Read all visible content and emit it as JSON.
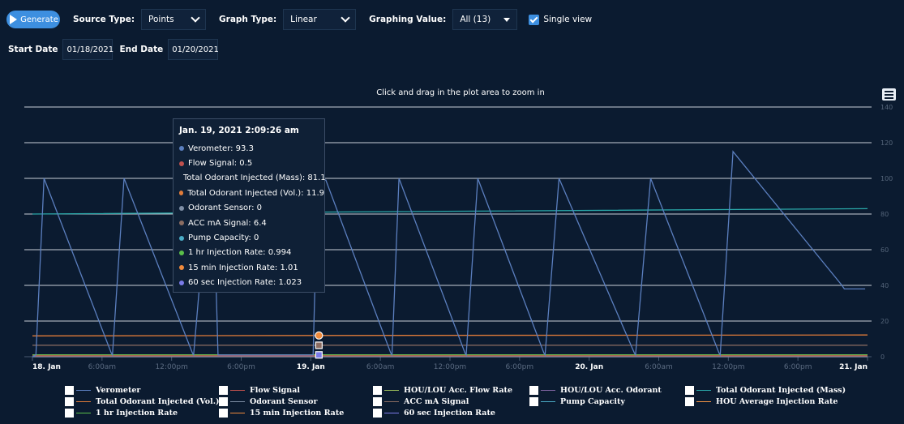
{
  "toolbar": {
    "generate_label": "Generate",
    "source_type_label": "Source Type:",
    "source_type_value": "Points",
    "graph_type_label": "Graph Type:",
    "graph_type_value": "Linear",
    "graphing_value_label": "Graphing Value:",
    "graphing_value_value": "All (13)",
    "single_view_label": "Single view",
    "single_view_checked": true
  },
  "dates": {
    "start_label": "Start Date",
    "start_value": "01/18/2021",
    "end_label": "End Date",
    "end_value": "01/20/2021"
  },
  "chart_data": {
    "type": "line",
    "subtitle": "Click and drag in the plot area to zoom in",
    "x_ticks": [
      "18. Jan",
      "6:00am",
      "12:00pm",
      "6:00pm",
      "19. Jan",
      "6:00am",
      "12:00pm",
      "6:00pm",
      "20. Jan",
      "6:00am",
      "12:00pm",
      "6:00pm",
      "21. Jan"
    ],
    "x_major_ticks": [
      "18. Jan",
      "19. Jan",
      "20. Jan",
      "21. Jan"
    ],
    "y_ticks": [
      0,
      20,
      40,
      60,
      80,
      100,
      120,
      140
    ],
    "ylim": [
      0,
      140
    ],
    "xlim_hours": [
      0,
      72
    ],
    "grid": true,
    "series": [
      {
        "name": "Verometer",
        "color": "#5b7fbf",
        "x": [
          0,
          0.3,
          1.0,
          6.8,
          6.9,
          7.9,
          13.8,
          13.9,
          15.2,
          15.6,
          16.0,
          24.2,
          24.6,
          25.3,
          30.9,
          31.0,
          31.6,
          37.3,
          37.4,
          38.4,
          44.1,
          44.2,
          45.4,
          51.9,
          52.0,
          53.3,
          59.2,
          59.3,
          60.4,
          69.8,
          70.0,
          71.8
        ],
        "values": [
          0,
          1,
          100,
          2,
          1,
          100,
          2,
          1,
          100,
          95,
          1,
          1,
          100,
          99,
          2,
          1,
          100,
          2,
          1,
          100,
          2,
          1,
          100,
          2,
          1,
          100,
          2,
          1,
          115,
          40,
          38,
          38
        ]
      },
      {
        "name": "Flow Signal",
        "color": "#c0504d",
        "x": [
          0,
          72
        ],
        "values": [
          0.5,
          0.5
        ]
      },
      {
        "name": "Total Odorant Injected (Mass)",
        "color": "#2aa7a8",
        "x": [
          0,
          24.7,
          72
        ],
        "values": [
          80,
          81.1,
          83
        ]
      },
      {
        "name": "Total Odorant Injected (Vol.)",
        "color": "#e07b39",
        "x": [
          0,
          24.7,
          72
        ],
        "values": [
          11.7,
          11.9,
          12.2
        ]
      },
      {
        "name": "Odorant Sensor",
        "color": "#7f8fa6",
        "x": [
          0,
          72
        ],
        "values": [
          0,
          0
        ]
      },
      {
        "name": "ACC mA Signal",
        "color": "#8c6d62",
        "x": [
          0,
          72
        ],
        "values": [
          6.4,
          6.4
        ]
      },
      {
        "name": "Pump Capacity",
        "color": "#4bacc6",
        "x": [
          0,
          72
        ],
        "values": [
          0,
          0
        ]
      },
      {
        "name": "1 hr Injection Rate",
        "color": "#5bbf4a",
        "x": [
          0,
          72
        ],
        "values": [
          0.994,
          0.994
        ]
      },
      {
        "name": "15 min Injection Rate",
        "color": "#f08a3c",
        "x": [
          0,
          72
        ],
        "values": [
          1.01,
          1.01
        ]
      },
      {
        "name": "60 sec Injection Rate",
        "color": "#7b7be8",
        "x": [
          0,
          72
        ],
        "values": [
          1.023,
          1.023
        ]
      }
    ],
    "tooltip": {
      "title": "Jan. 19, 2021 2:09:26 am",
      "rows": [
        {
          "label": "Verometer: 93.3",
          "color": "#5b7fbf"
        },
        {
          "label": "Flow Signal: 0.5",
          "color": "#c0504d"
        },
        {
          "label": "Total Odorant Injected (Mass): 81.1",
          "color": "#2aa7a8"
        },
        {
          "label": "Total Odorant Injected (Vol.): 11.9",
          "color": "#e07b39"
        },
        {
          "label": "Odorant Sensor: 0",
          "color": "#7f8fa6"
        },
        {
          "label": "ACC mA Signal: 6.4",
          "color": "#8c6d62"
        },
        {
          "label": "Pump Capacity: 0",
          "color": "#4bacc6"
        },
        {
          "label": "1 hr Injection Rate: 0.994",
          "color": "#5bbf4a"
        },
        {
          "label": "15 min Injection Rate: 1.01",
          "color": "#f08a3c"
        },
        {
          "label": "60 sec Injection Rate: 1.023",
          "color": "#7b7be8"
        }
      ]
    },
    "legend": [
      {
        "label": "Verometer",
        "color": "#5b7fbf"
      },
      {
        "label": "Flow Signal",
        "color": "#c0504d"
      },
      {
        "label": "HOU/LOU Acc. Flow Rate",
        "color": "#9bbb59"
      },
      {
        "label": "HOU/LOU Acc. Odorant",
        "color": "#8064a2"
      },
      {
        "label": "Total Odorant Injected (Mass)",
        "color": "#2aa7a8"
      },
      {
        "label": "Total Odorant Injected (Vol.)",
        "color": "#e07b39"
      },
      {
        "label": "Odorant Sensor",
        "color": "#7f8fa6"
      },
      {
        "label": "ACC mA Signal",
        "color": "#8c6d62"
      },
      {
        "label": "Pump Capacity",
        "color": "#4bacc6"
      },
      {
        "label": "HOU Average Injection Rate",
        "color": "#f79646"
      },
      {
        "label": "1 hr Injection Rate",
        "color": "#5bbf4a"
      },
      {
        "label": "15 min Injection Rate",
        "color": "#f08a3c"
      },
      {
        "label": "60 sec Injection Rate",
        "color": "#7b7be8"
      }
    ]
  }
}
